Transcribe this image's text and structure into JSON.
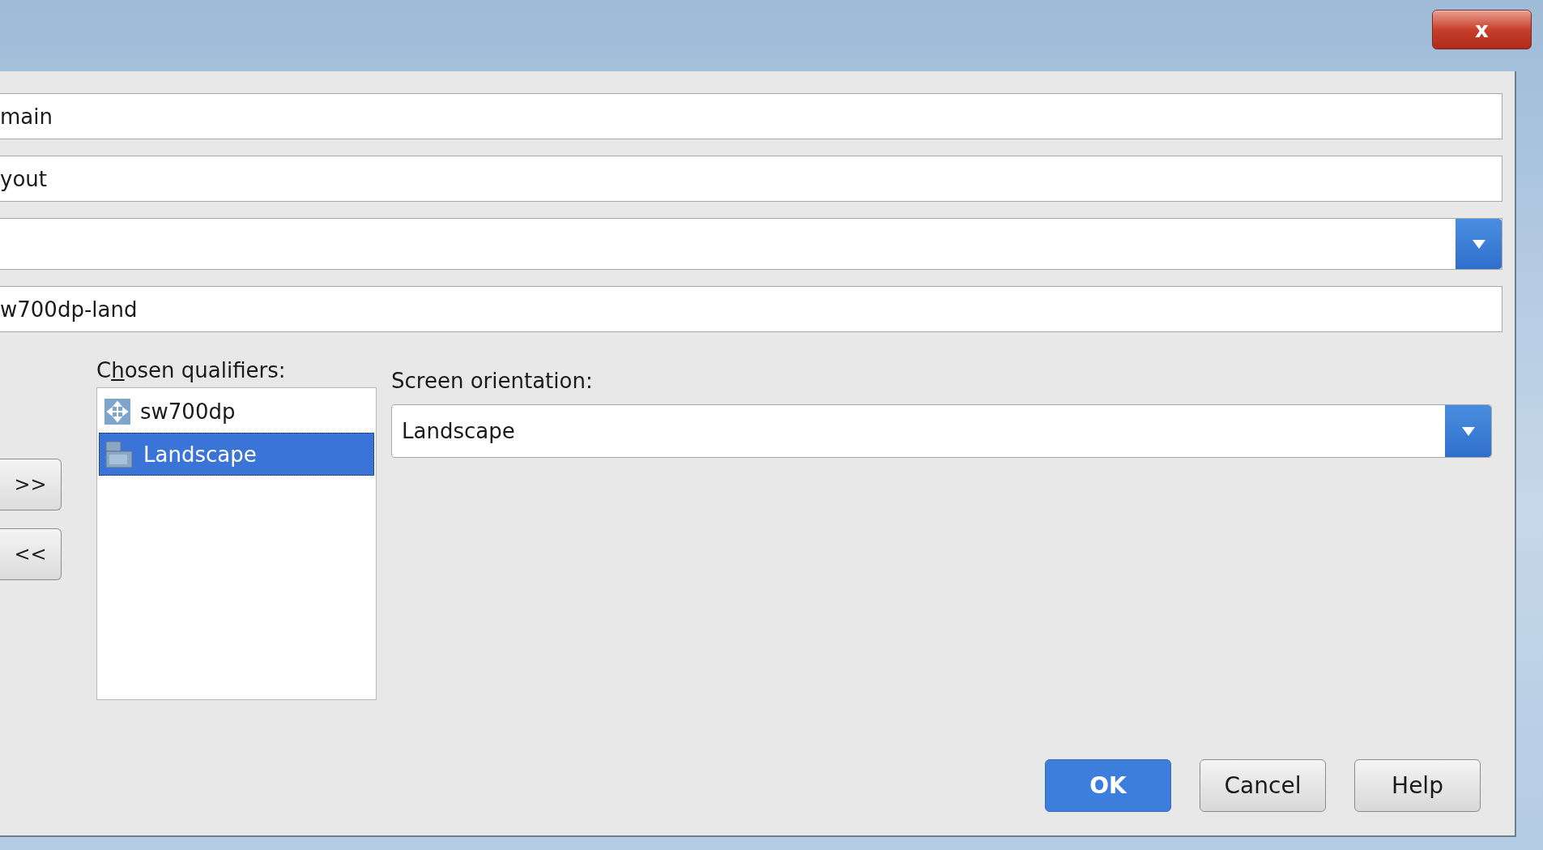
{
  "window": {
    "close_label": "x"
  },
  "fields": [
    {
      "kind": "text",
      "value": "main"
    },
    {
      "kind": "text",
      "value": "yout"
    },
    {
      "kind": "dropdown"
    },
    {
      "kind": "text",
      "value": "w700dp-land"
    }
  ],
  "move_buttons": [
    ">>",
    "<<"
  ],
  "chosen_qualifiers": {
    "label_parts": [
      "C",
      "h",
      "osen qualifiers:"
    ],
    "items": [
      {
        "label": "sw700dp",
        "kind": "size",
        "selected": false
      },
      {
        "label": "Landscape",
        "kind": "orientation",
        "selected": true
      }
    ]
  },
  "screen_orientation": {
    "label": "Screen orientation:",
    "value": "Landscape"
  },
  "buttons": [
    {
      "label": "OK",
      "default": true
    },
    {
      "label": "Cancel",
      "default": false
    },
    {
      "label": "Help",
      "default": false
    }
  ]
}
